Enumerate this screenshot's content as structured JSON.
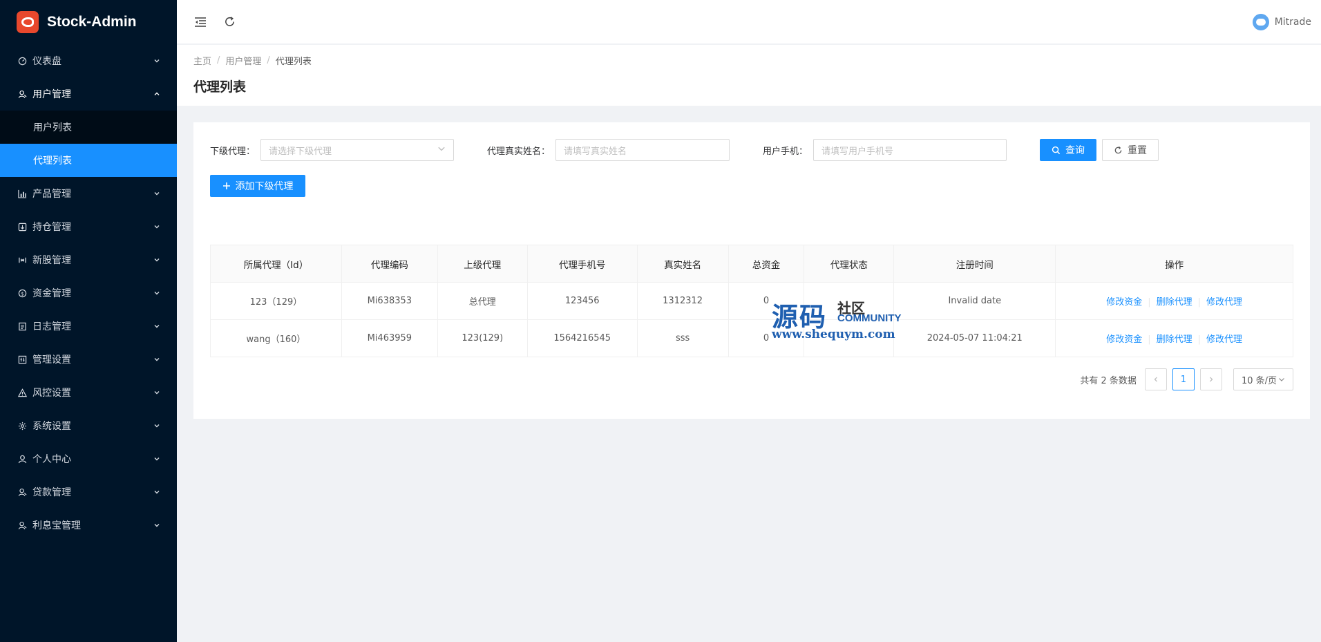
{
  "app": {
    "title": "Stock-Admin"
  },
  "sidebar": {
    "items": [
      {
        "label": "仪表盘",
        "icon": "dashboard-icon"
      },
      {
        "label": "用户管理",
        "icon": "user-manage-icon",
        "open": true,
        "children": [
          {
            "label": "用户列表"
          },
          {
            "label": "代理列表",
            "active": true
          }
        ]
      },
      {
        "label": "产品管理",
        "icon": "chart-icon"
      },
      {
        "label": "持仓管理",
        "icon": "position-icon"
      },
      {
        "label": "新股管理",
        "icon": "ipo-icon"
      },
      {
        "label": "资金管理",
        "icon": "money-icon"
      },
      {
        "label": "日志管理",
        "icon": "log-icon"
      },
      {
        "label": "管理设置",
        "icon": "admin-settings-icon"
      },
      {
        "label": "风控设置",
        "icon": "warning-icon"
      },
      {
        "label": "系统设置",
        "icon": "gear-icon"
      },
      {
        "label": "个人中心",
        "icon": "person-icon"
      },
      {
        "label": "贷款管理",
        "icon": "loan-icon"
      },
      {
        "label": "利息宝管理",
        "icon": "interest-icon"
      }
    ]
  },
  "header": {
    "user_name": "Mitrade"
  },
  "breadcrumb": [
    "主页",
    "用户管理",
    "代理列表"
  ],
  "page_title": "代理列表",
  "filters": {
    "sub_agent_label": "下级代理：",
    "sub_agent_placeholder": "请选择下级代理",
    "real_name_label": "代理真实姓名：",
    "real_name_placeholder": "请填写真实姓名",
    "phone_label": "用户手机：",
    "phone_placeholder": "请填写用户手机号",
    "search_label": "查询",
    "reset_label": "重置"
  },
  "add_button_label": "添加下级代理",
  "table": {
    "columns": [
      "所属代理（Id）",
      "代理编码",
      "上级代理",
      "代理手机号",
      "真实姓名",
      "总资金",
      "代理状态",
      "注册时间",
      "操作"
    ],
    "rows": [
      {
        "agent": "123（129）",
        "code": "Mi638353",
        "parent": "总代理",
        "phone": "123456",
        "name": "1312312",
        "funds": "0",
        "status": "",
        "reg_time": "Invalid date"
      },
      {
        "agent": "wang（160）",
        "code": "Mi463959",
        "parent": "123(129)",
        "phone": "1564216545",
        "name": "sss",
        "funds": "0",
        "status": "",
        "reg_time": "2024-05-07 11:04:21"
      }
    ],
    "actions": [
      "修改资金",
      "删除代理",
      "修改代理"
    ]
  },
  "pagination": {
    "total_text": "共有 2 条数据",
    "current_page": "1",
    "page_size": "10 条/页"
  },
  "watermark": {
    "big": "源码",
    "small": "社区",
    "community": "COMMUNITY",
    "url": "www.shequym.com"
  }
}
